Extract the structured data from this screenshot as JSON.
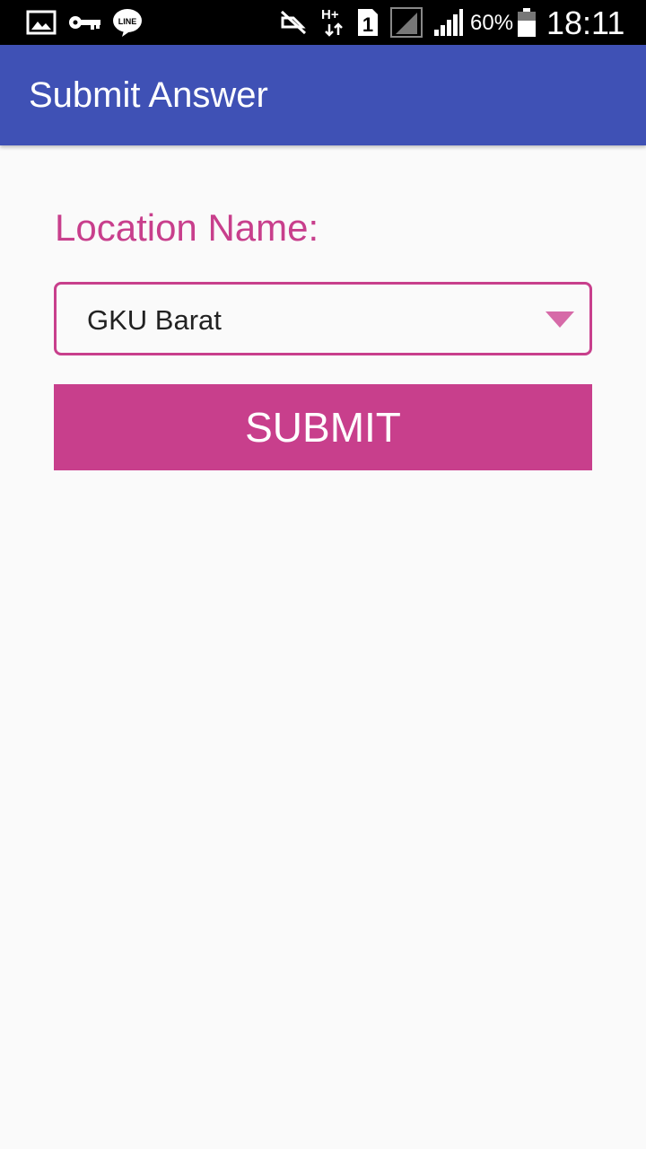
{
  "status_bar": {
    "battery_percent": "60%",
    "time": "18:11",
    "sim_label": "1",
    "network_type": "H+",
    "icons": [
      "image-icon",
      "key-icon",
      "line-app-icon",
      "mute-icon",
      "network-hplus-icon",
      "sim-1-icon",
      "signal-no-service-icon",
      "signal-strength-icon",
      "battery-icon"
    ]
  },
  "app_bar": {
    "title": "Submit Answer",
    "color": "#3f51b5"
  },
  "form": {
    "location_label": "Location Name:",
    "location_selected": "GKU Barat",
    "submit_label": "SUBMIT",
    "accent_color": "#c83f8c"
  }
}
